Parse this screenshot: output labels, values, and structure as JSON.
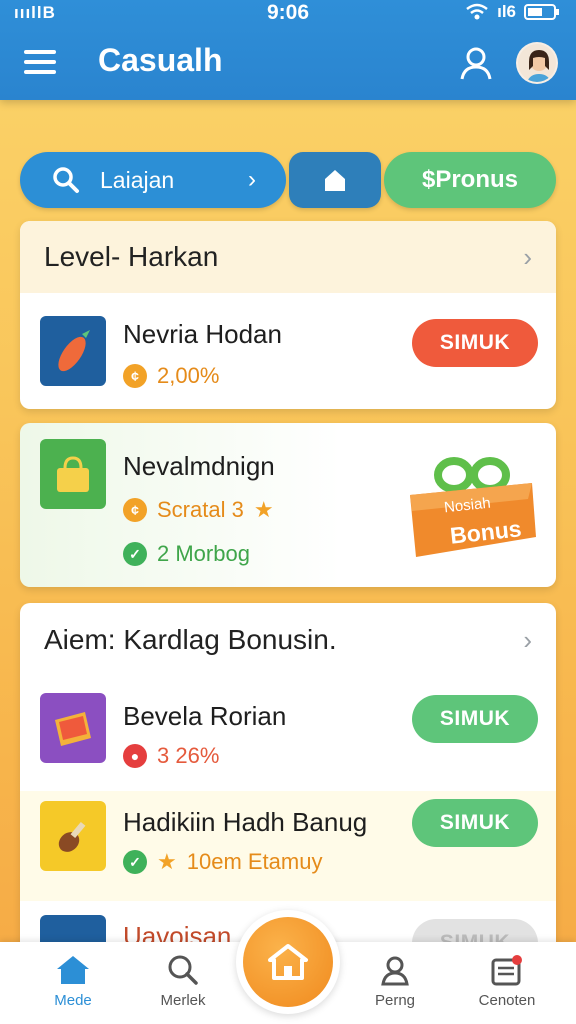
{
  "status": {
    "signal": "ıııllB",
    "time": "9:06",
    "net": "ıl6"
  },
  "header": {
    "title": "Casualh"
  },
  "pills": {
    "search_label": "Laiajan",
    "bonus_label": "$Pronus"
  },
  "section1": {
    "title": "Level- Harkan",
    "rows": [
      {
        "title": "Nevria Hodan",
        "sub": "2,00%",
        "button": "SIMUK"
      },
      {
        "title": "Nevalmdnign",
        "sub": "Scratal 3",
        "sub2": "2 Morbog",
        "badge_top": "Nosiah",
        "badge_main": "Bonus"
      }
    ]
  },
  "section2": {
    "title": "Aiem: Kardlag Bonusin.",
    "rows": [
      {
        "title": "Bevela Rorian",
        "sub": "3 26%",
        "button": "SIMUK"
      },
      {
        "title": "Hadikiin Hadh Banug",
        "sub": "10em Etamuy",
        "button": "SIMUK"
      },
      {
        "title": "Uavoisan",
        "button": "SIMUK"
      }
    ]
  },
  "nav": {
    "home": "Mede",
    "search": "Merlek",
    "profile": "Perng",
    "settings": "Cenoten"
  },
  "colors": {
    "primary": "#2c8fd6",
    "accent_green": "#5ec57a",
    "accent_red": "#ef5a3c",
    "accent_orange": "#f5a623"
  }
}
